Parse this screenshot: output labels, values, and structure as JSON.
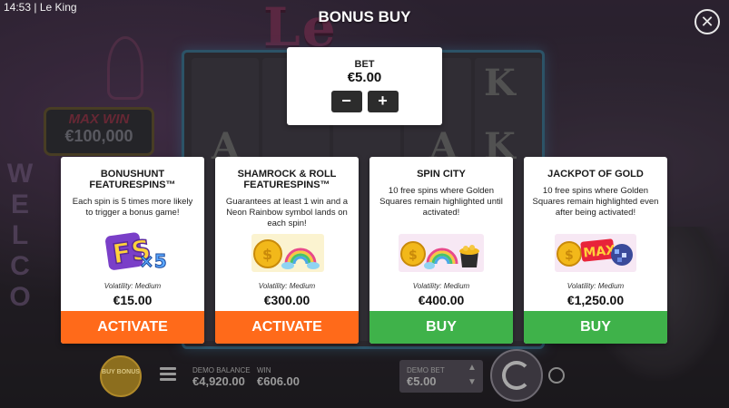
{
  "status_bar": {
    "time": "14:53",
    "separator": "|",
    "app_name": "Le King"
  },
  "background": {
    "logo_text": "Le King",
    "max_win_label": "MAX WIN",
    "max_win_value": "€100,000",
    "welcome_sign": "WELCOME"
  },
  "modal": {
    "title": "BONUS BUY",
    "close_icon": "close-icon",
    "bet": {
      "label": "BET",
      "value": "€5.00",
      "decrease_label": "−",
      "increase_label": "+"
    },
    "cards": [
      {
        "title": "BONUSHUNT FEATURESPINS™",
        "description": "Each spin is 5 times more likely to trigger a bonus game!",
        "art": "fs-x5-icon",
        "art_text": "FS",
        "art_multiplier": "×5",
        "volatility": "Volatility: Medium",
        "price": "€15.00",
        "action": "ACTIVATE",
        "action_color": "#ff6a1a"
      },
      {
        "title": "SHAMROCK & ROLL FEATURESPINS™",
        "description": "Guarantees at least 1 win and a Neon Rainbow symbol lands on each spin!",
        "art": "coin-rainbow-icon",
        "volatility": "Volatility: Medium",
        "price": "€300.00",
        "action": "ACTIVATE",
        "action_color": "#ff6a1a"
      },
      {
        "title": "SPIN CITY",
        "description": "10 free spins where Golden Squares remain highlighted until activated!",
        "art": "coin-rainbow-pot-icon",
        "volatility": "Volatility: Medium",
        "price": "€400.00",
        "action": "BUY",
        "action_color": "#3fb24a"
      },
      {
        "title": "JACKPOT OF GOLD",
        "description": "10 free spins where Golden Squares remain highlighted even after being activated!",
        "art": "coin-max-disco-icon",
        "art_text": "MAX",
        "volatility": "Volatility: Medium",
        "price": "€1,250.00",
        "action": "BUY",
        "action_color": "#3fb24a"
      }
    ]
  },
  "hud": {
    "buy_bonus_label": "BUY BONUS",
    "balance_label": "DEMO BALANCE",
    "balance_value": "€4,920.00",
    "win_label": "WIN",
    "win_value": "€606.00",
    "bet_label": "DEMO BET",
    "bet_value": "€5.00",
    "icons": [
      "menu-icon",
      "chevron-up-icon",
      "chevron-down-icon",
      "spin-icon",
      "autoplay-icon"
    ]
  },
  "colors": {
    "activate": "#ff6a1a",
    "buy": "#3fb24a",
    "panel": "#ffffff"
  }
}
